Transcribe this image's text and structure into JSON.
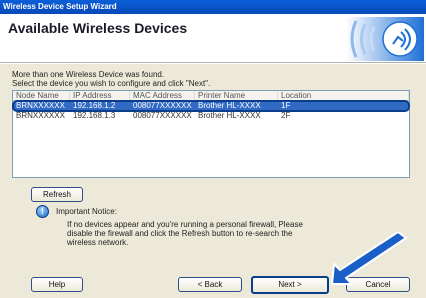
{
  "window": {
    "title": "Wireless Device Setup Wizard"
  },
  "banner": {
    "heading": "Available Wireless Devices"
  },
  "intro": {
    "line1": "More than one Wireless Device was found.",
    "line2": "Select the device you wish to configure and click \"Next\"."
  },
  "device_list": {
    "columns": [
      "Node Name",
      "IP Address",
      "MAC Address",
      "Printer Name",
      "Location"
    ],
    "rows": [
      [
        "BRNXXXXXX",
        "192.168.1.2",
        "008077XXXXXX",
        "Brother HL-XXXX",
        "1F"
      ],
      [
        "BRNXXXXXX",
        "192.168.1.3",
        "008077XXXXXX",
        "Brother HL-XXXX",
        "2F"
      ]
    ],
    "selected_row": 0
  },
  "refresh_button": "Refresh",
  "notice": {
    "title": "Important Notice:",
    "line1": "If no devices appear and you're running a personal firewall, Please",
    "line2": "disable the firewall and click the Refresh button to re-search the",
    "line3": "wireless network."
  },
  "footer": {
    "help": "Help",
    "back": "< Back",
    "next": "Next >",
    "cancel": "Cancel"
  },
  "colors": {
    "accent": "#0b5fd0",
    "selection": "#316ac5",
    "arrow": "#1a5fc8"
  },
  "icons": [
    "wireless-logo-icon",
    "info-icon",
    "pointer-arrow-icon"
  ]
}
